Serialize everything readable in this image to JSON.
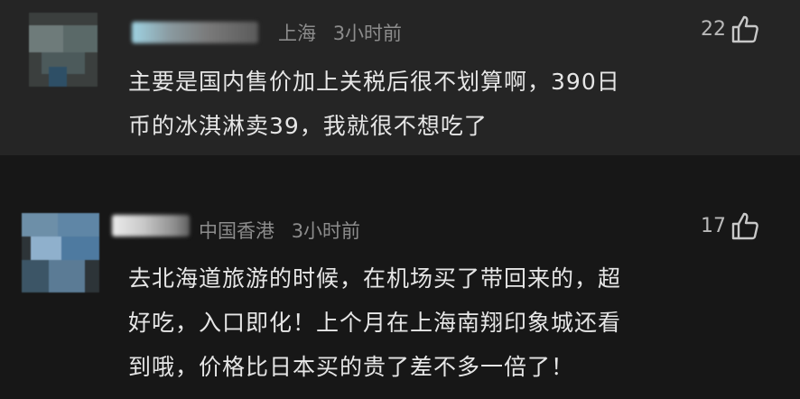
{
  "comments": [
    {
      "location": "上海",
      "time": "3小时前",
      "likes": "22",
      "text_lines": [
        "主要是国内售价加上关税后很不划算啊，390日",
        "币的冰淇淋卖39，我就很不想吃了"
      ],
      "icon": "thumbs-up-icon"
    },
    {
      "location": "中国香港",
      "time": "3小时前",
      "likes": "17",
      "text_lines": [
        "去北海道旅游的时候，在机场买了带回来的，超",
        "好吃，入口即化！上个月在上海南翔印象城还看",
        "到哦，价格比日本买的贵了差不多一倍了！"
      ],
      "icon": "thumbs-up-icon"
    }
  ]
}
